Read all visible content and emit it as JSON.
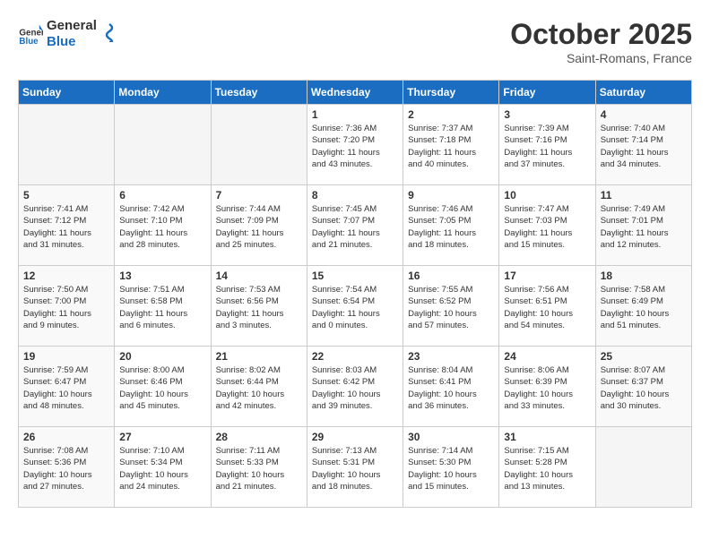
{
  "header": {
    "logo_general": "General",
    "logo_blue": "Blue",
    "month_title": "October 2025",
    "location": "Saint-Romans, France"
  },
  "weekdays": [
    "Sunday",
    "Monday",
    "Tuesday",
    "Wednesday",
    "Thursday",
    "Friday",
    "Saturday"
  ],
  "weeks": [
    [
      {
        "day": "",
        "info": ""
      },
      {
        "day": "",
        "info": ""
      },
      {
        "day": "",
        "info": ""
      },
      {
        "day": "1",
        "info": "Sunrise: 7:36 AM\nSunset: 7:20 PM\nDaylight: 11 hours\nand 43 minutes."
      },
      {
        "day": "2",
        "info": "Sunrise: 7:37 AM\nSunset: 7:18 PM\nDaylight: 11 hours\nand 40 minutes."
      },
      {
        "day": "3",
        "info": "Sunrise: 7:39 AM\nSunset: 7:16 PM\nDaylight: 11 hours\nand 37 minutes."
      },
      {
        "day": "4",
        "info": "Sunrise: 7:40 AM\nSunset: 7:14 PM\nDaylight: 11 hours\nand 34 minutes."
      }
    ],
    [
      {
        "day": "5",
        "info": "Sunrise: 7:41 AM\nSunset: 7:12 PM\nDaylight: 11 hours\nand 31 minutes."
      },
      {
        "day": "6",
        "info": "Sunrise: 7:42 AM\nSunset: 7:10 PM\nDaylight: 11 hours\nand 28 minutes."
      },
      {
        "day": "7",
        "info": "Sunrise: 7:44 AM\nSunset: 7:09 PM\nDaylight: 11 hours\nand 25 minutes."
      },
      {
        "day": "8",
        "info": "Sunrise: 7:45 AM\nSunset: 7:07 PM\nDaylight: 11 hours\nand 21 minutes."
      },
      {
        "day": "9",
        "info": "Sunrise: 7:46 AM\nSunset: 7:05 PM\nDaylight: 11 hours\nand 18 minutes."
      },
      {
        "day": "10",
        "info": "Sunrise: 7:47 AM\nSunset: 7:03 PM\nDaylight: 11 hours\nand 15 minutes."
      },
      {
        "day": "11",
        "info": "Sunrise: 7:49 AM\nSunset: 7:01 PM\nDaylight: 11 hours\nand 12 minutes."
      }
    ],
    [
      {
        "day": "12",
        "info": "Sunrise: 7:50 AM\nSunset: 7:00 PM\nDaylight: 11 hours\nand 9 minutes."
      },
      {
        "day": "13",
        "info": "Sunrise: 7:51 AM\nSunset: 6:58 PM\nDaylight: 11 hours\nand 6 minutes."
      },
      {
        "day": "14",
        "info": "Sunrise: 7:53 AM\nSunset: 6:56 PM\nDaylight: 11 hours\nand 3 minutes."
      },
      {
        "day": "15",
        "info": "Sunrise: 7:54 AM\nSunset: 6:54 PM\nDaylight: 11 hours\nand 0 minutes."
      },
      {
        "day": "16",
        "info": "Sunrise: 7:55 AM\nSunset: 6:52 PM\nDaylight: 10 hours\nand 57 minutes."
      },
      {
        "day": "17",
        "info": "Sunrise: 7:56 AM\nSunset: 6:51 PM\nDaylight: 10 hours\nand 54 minutes."
      },
      {
        "day": "18",
        "info": "Sunrise: 7:58 AM\nSunset: 6:49 PM\nDaylight: 10 hours\nand 51 minutes."
      }
    ],
    [
      {
        "day": "19",
        "info": "Sunrise: 7:59 AM\nSunset: 6:47 PM\nDaylight: 10 hours\nand 48 minutes."
      },
      {
        "day": "20",
        "info": "Sunrise: 8:00 AM\nSunset: 6:46 PM\nDaylight: 10 hours\nand 45 minutes."
      },
      {
        "day": "21",
        "info": "Sunrise: 8:02 AM\nSunset: 6:44 PM\nDaylight: 10 hours\nand 42 minutes."
      },
      {
        "day": "22",
        "info": "Sunrise: 8:03 AM\nSunset: 6:42 PM\nDaylight: 10 hours\nand 39 minutes."
      },
      {
        "day": "23",
        "info": "Sunrise: 8:04 AM\nSunset: 6:41 PM\nDaylight: 10 hours\nand 36 minutes."
      },
      {
        "day": "24",
        "info": "Sunrise: 8:06 AM\nSunset: 6:39 PM\nDaylight: 10 hours\nand 33 minutes."
      },
      {
        "day": "25",
        "info": "Sunrise: 8:07 AM\nSunset: 6:37 PM\nDaylight: 10 hours\nand 30 minutes."
      }
    ],
    [
      {
        "day": "26",
        "info": "Sunrise: 7:08 AM\nSunset: 5:36 PM\nDaylight: 10 hours\nand 27 minutes."
      },
      {
        "day": "27",
        "info": "Sunrise: 7:10 AM\nSunset: 5:34 PM\nDaylight: 10 hours\nand 24 minutes."
      },
      {
        "day": "28",
        "info": "Sunrise: 7:11 AM\nSunset: 5:33 PM\nDaylight: 10 hours\nand 21 minutes."
      },
      {
        "day": "29",
        "info": "Sunrise: 7:13 AM\nSunset: 5:31 PM\nDaylight: 10 hours\nand 18 minutes."
      },
      {
        "day": "30",
        "info": "Sunrise: 7:14 AM\nSunset: 5:30 PM\nDaylight: 10 hours\nand 15 minutes."
      },
      {
        "day": "31",
        "info": "Sunrise: 7:15 AM\nSunset: 5:28 PM\nDaylight: 10 hours\nand 13 minutes."
      },
      {
        "day": "",
        "info": ""
      }
    ]
  ]
}
